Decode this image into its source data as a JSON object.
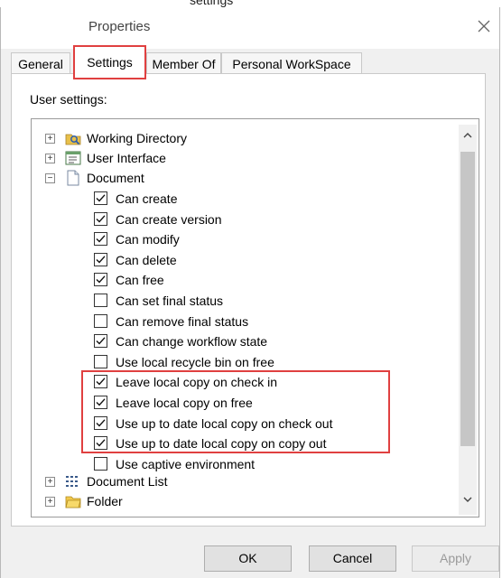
{
  "window": {
    "title": "Properties",
    "close_icon": "close-icon"
  },
  "top_fragment": "settings",
  "tabs": [
    {
      "label": "General",
      "selected": false
    },
    {
      "label": "Settings",
      "selected": true
    },
    {
      "label": "Member Of",
      "selected": false
    },
    {
      "label": "Personal WorkSpace",
      "selected": false
    }
  ],
  "settings_label": "User settings:",
  "tree": {
    "nodes": [
      {
        "label": "Working Directory",
        "expander": "+",
        "icon": "folder-search-icon"
      },
      {
        "label": "User Interface",
        "expander": "+",
        "icon": "window-form-icon"
      },
      {
        "label": "Document",
        "expander": "−",
        "icon": "document-icon"
      }
    ],
    "document_options": [
      {
        "label": "Can create",
        "checked": true
      },
      {
        "label": "Can create version",
        "checked": true
      },
      {
        "label": "Can modify",
        "checked": true
      },
      {
        "label": "Can delete",
        "checked": true
      },
      {
        "label": "Can free",
        "checked": true
      },
      {
        "label": "Can set final status",
        "checked": false
      },
      {
        "label": "Can remove final status",
        "checked": false
      },
      {
        "label": "Can change workflow state",
        "checked": true
      },
      {
        "label": "Use local recycle bin on free",
        "checked": false
      },
      {
        "label": "Leave local copy on check in",
        "checked": true
      },
      {
        "label": "Leave local copy on free",
        "checked": true
      },
      {
        "label": "Use up to date local copy on check out",
        "checked": true
      },
      {
        "label": "Use up to date local copy on copy out",
        "checked": true
      },
      {
        "label": "Use captive environment",
        "checked": false
      }
    ],
    "trailing_nodes": [
      {
        "label": "Document List",
        "expander": "+",
        "icon": "document-list-icon"
      },
      {
        "label": "Folder",
        "expander": "+",
        "icon": "folder-icon"
      }
    ]
  },
  "buttons": {
    "ok": "OK",
    "cancel": "Cancel",
    "apply": "Apply"
  },
  "colors": {
    "highlight": "#e04040",
    "dialog_bg": "#f0f0f0"
  }
}
